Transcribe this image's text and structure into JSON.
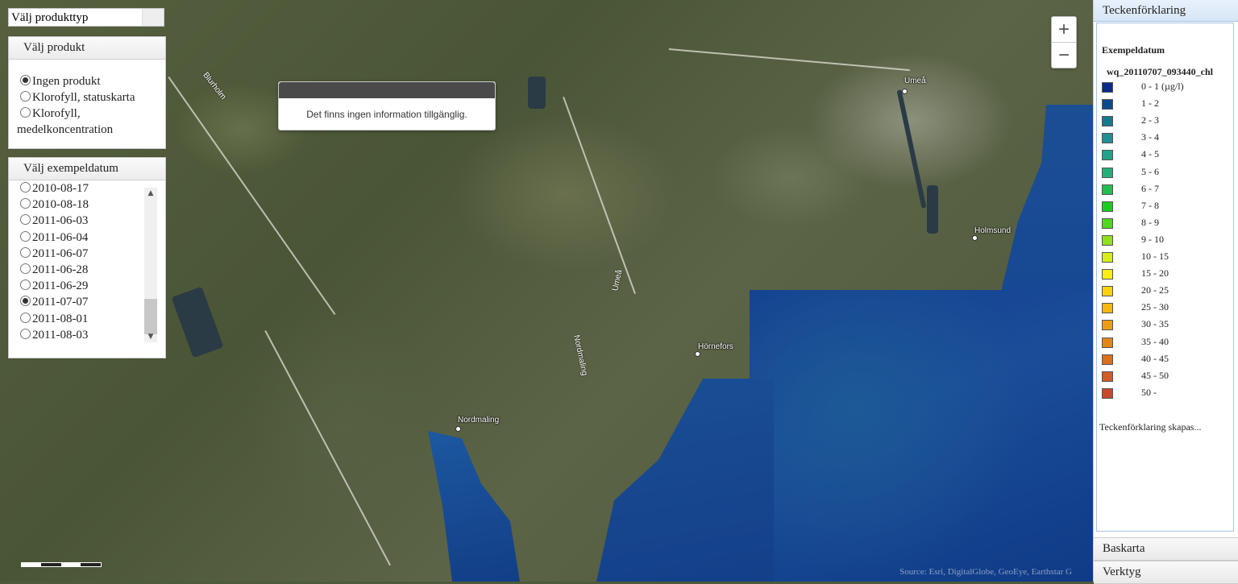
{
  "product_type": {
    "label": "Välj produkttyp"
  },
  "product_panel": {
    "title": "Välj produkt",
    "options": [
      {
        "label": "Ingen produkt",
        "selected": true
      },
      {
        "label": "Klorofyll, statuskarta",
        "selected": false
      },
      {
        "label": "Klorofyll,",
        "label2": "medelkoncentration",
        "selected": false
      }
    ]
  },
  "date_panel": {
    "title": "Välj exempeldatum",
    "dates": [
      {
        "label": "2010-08-17",
        "selected": false
      },
      {
        "label": "2010-08-18",
        "selected": false
      },
      {
        "label": "2011-06-03",
        "selected": false
      },
      {
        "label": "2011-06-04",
        "selected": false
      },
      {
        "label": "2011-06-07",
        "selected": false
      },
      {
        "label": "2011-06-28",
        "selected": false
      },
      {
        "label": "2011-06-29",
        "selected": false
      },
      {
        "label": "2011-07-07",
        "selected": true
      },
      {
        "label": "2011-08-01",
        "selected": false
      },
      {
        "label": "2011-08-03",
        "selected": false
      }
    ]
  },
  "popup": {
    "message": "Det finns ingen information tillgänglig."
  },
  "map": {
    "zoom_in": "+",
    "zoom_out": "−",
    "attribution": "Source: Esri, DigitalGlobe, GeoEye, Earthstar G",
    "places": [
      "Umeå",
      "Holmsund",
      "Hörnefors",
      "Nordmaling"
    ],
    "roads": [
      "Blurholm",
      "Umeå",
      "Nordmaling"
    ]
  },
  "legend": {
    "header": "Teckenförklaring",
    "section": "Exempeldatum",
    "layer": "wq_20110707_093440_chl",
    "status": "Teckenförklaring skapas...",
    "items": [
      {
        "label": "0 - 1 (µg/l)",
        "color": "#0a2a8a"
      },
      {
        "label": "1 - 2",
        "color": "#0b4a8c"
      },
      {
        "label": "2 - 3",
        "color": "#157a8e"
      },
      {
        "label": "3 - 4",
        "color": "#1f8f91"
      },
      {
        "label": "4 - 5",
        "color": "#21a28a"
      },
      {
        "label": "5 - 6",
        "color": "#22b07a"
      },
      {
        "label": "6 - 7",
        "color": "#22bf4f"
      },
      {
        "label": "7 - 8",
        "color": "#19cc22"
      },
      {
        "label": "8 - 9",
        "color": "#4fd81e"
      },
      {
        "label": "9 - 10",
        "color": "#8fe01c"
      },
      {
        "label": "10 - 15",
        "color": "#d8ec16"
      },
      {
        "label": "15 - 20",
        "color": "#fbee0f"
      },
      {
        "label": "20 - 25",
        "color": "#fbd20b"
      },
      {
        "label": "25 - 30",
        "color": "#f5b90e"
      },
      {
        "label": "30 - 35",
        "color": "#ec9e12"
      },
      {
        "label": "35 - 40",
        "color": "#e28618"
      },
      {
        "label": "40 - 45",
        "color": "#d9701e"
      },
      {
        "label": "45 - 50",
        "color": "#d05c26"
      },
      {
        "label": "50 -",
        "color": "#c8482c"
      }
    ]
  },
  "accordion": {
    "basemap": "Baskarta",
    "tools": "Verktyg"
  }
}
